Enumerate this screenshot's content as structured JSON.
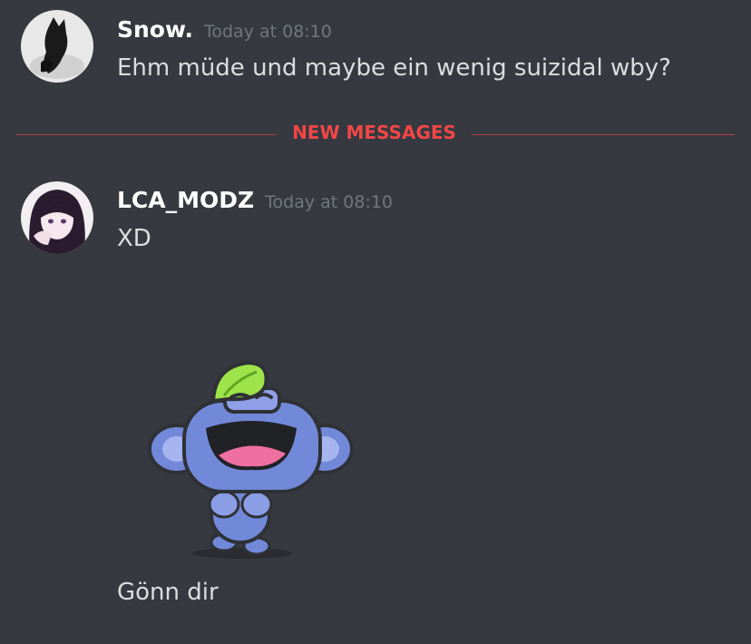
{
  "messages": [
    {
      "author": "Snow.",
      "timestamp": "Today at 08:10",
      "text": "Ehm müde und maybe ein wenig suizidal wby?"
    },
    {
      "author": "LCA_MODZ",
      "timestamp": "Today at 08:10",
      "text": "XD",
      "sticker_icon": "wumpus-laughing-sticker",
      "caption": "Gönn dir"
    }
  ],
  "divider": {
    "label": "NEW MESSAGES",
    "color": "#f04747"
  },
  "colors": {
    "background": "#36393f",
    "username": "#ffffff",
    "timestamp": "#72767d",
    "message_text": "#dcddde"
  }
}
